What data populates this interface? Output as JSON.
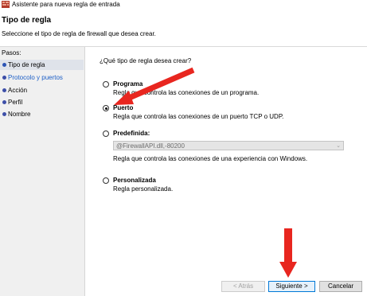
{
  "window": {
    "title": "Asistente para nueva regla de entrada",
    "icon": "firewall-app-icon"
  },
  "header": {
    "title": "Tipo de regla",
    "subtitle": "Seleccione el tipo de regla de firewall que desea crear."
  },
  "sidebar": {
    "label": "Pasos:",
    "steps": [
      {
        "label": "Tipo de regla",
        "state": "current"
      },
      {
        "label": "Protocolo y puertos",
        "state": "link"
      },
      {
        "label": "Acción",
        "state": "normal"
      },
      {
        "label": "Perfil",
        "state": "normal"
      },
      {
        "label": "Nombre",
        "state": "normal"
      }
    ]
  },
  "main": {
    "question": "¿Qué tipo de regla desea crear?",
    "options": [
      {
        "title": "Programa",
        "desc": "Regla que controla las conexiones de un programa.",
        "selected": false
      },
      {
        "title": "Puerto",
        "desc": "Regla que controla las conexiones de un puerto TCP o UDP.",
        "selected": true
      },
      {
        "title": "Predefinida:",
        "desc": "Regla que controla las conexiones de una experiencia con Windows.",
        "selected": false
      },
      {
        "title": "Personalizada",
        "desc": "Regla personalizada.",
        "selected": false
      }
    ],
    "predefined_select": {
      "value": "@FirewallAPI.dll,-80200",
      "enabled": false
    }
  },
  "buttons": {
    "back": "< Atrás",
    "next": "Siguiente >",
    "cancel": "Cancelar"
  },
  "colors": {
    "annotation_arrow": "#e8261f",
    "link": "#1c5ec6",
    "accent_border": "#0078d7"
  }
}
